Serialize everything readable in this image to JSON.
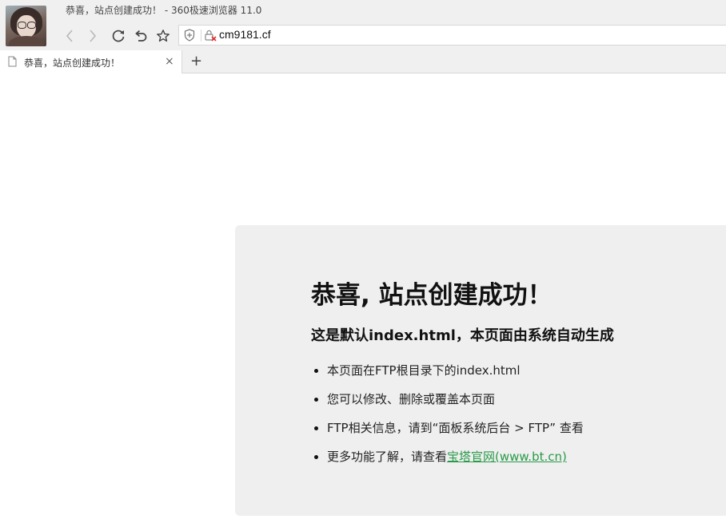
{
  "window": {
    "title": "恭喜，站点创建成功！ - 360极速浏览器 11.0"
  },
  "toolbar": {
    "back_icon": "chevron-left-icon",
    "forward_icon": "chevron-right-icon",
    "reload_icon": "reload-icon",
    "undo_icon": "undo-icon",
    "favorite_icon": "star-icon"
  },
  "address_bar": {
    "security_icon": "shield-icon",
    "lock_icon": "insecure-lock-icon",
    "url": "cm9181.cf"
  },
  "tabs": [
    {
      "label": "恭喜，站点创建成功！",
      "close": "×"
    }
  ],
  "new_tab_label": "+",
  "page": {
    "heading": "恭喜, 站点创建成功！",
    "subheading": "这是默认index.html，本页面由系统自动生成",
    "items": [
      "本页面在FTP根目录下的index.html",
      "您可以修改、删除或覆盖本页面",
      "FTP相关信息，请到“面板系统后台 > FTP” 查看"
    ],
    "last_item_prefix": "更多功能了解，请查看",
    "link_text": "宝塔官网(www.bt.cn)",
    "link_color": "#2a9a4a"
  }
}
